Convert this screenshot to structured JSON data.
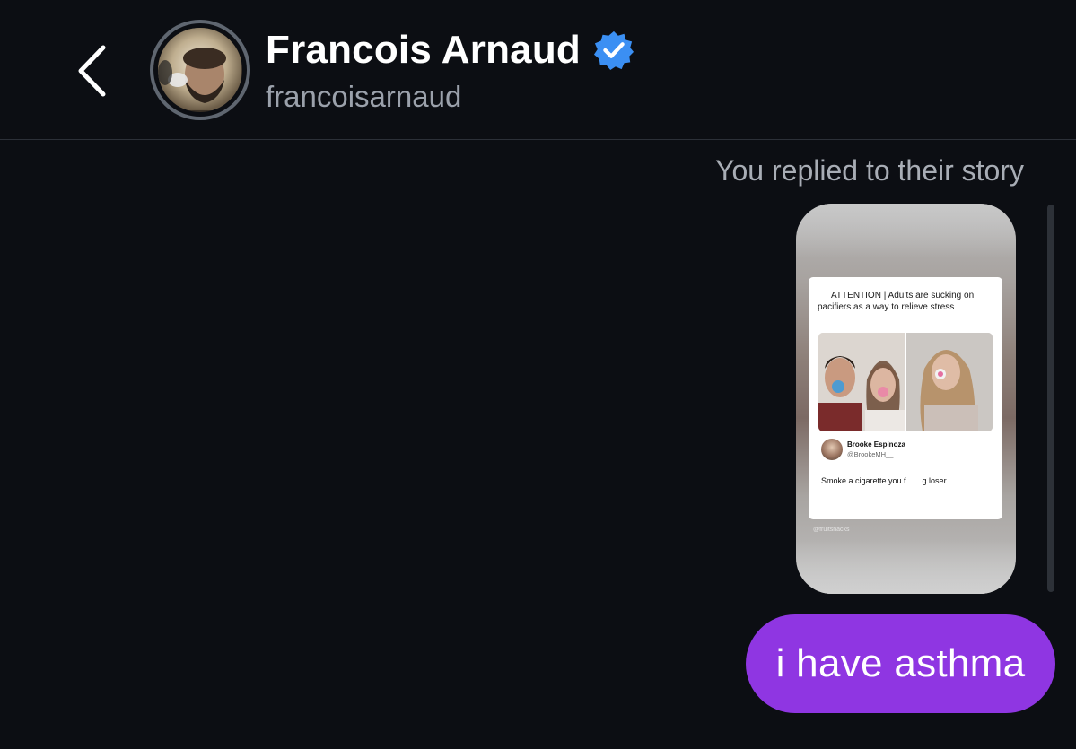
{
  "header": {
    "back_icon": "chevron-left-icon",
    "avatar_icon": "profile-photo",
    "display_name": "Francois Arnaud",
    "verified_icon": "verified-badge-icon",
    "handle": "francoisarnaud"
  },
  "conversation": {
    "reply_note": "You replied to their story",
    "story": {
      "tweet_headline": "ATTENTION | Adults are sucking on pacifiers as a way to relieve stress",
      "reply_author_name": "Brooke Espinoza",
      "reply_author_handle": "@BrookeMH__",
      "reply_text": "Smoke a cigarette you f……g loser",
      "watermark": "@fruitsnacks"
    },
    "message": {
      "text": "i have asthma"
    }
  },
  "colors": {
    "background": "#0c0e13",
    "bubble": "#8f36e2",
    "verified": "#3b8ff3",
    "secondary_text": "#9ba1ab"
  }
}
